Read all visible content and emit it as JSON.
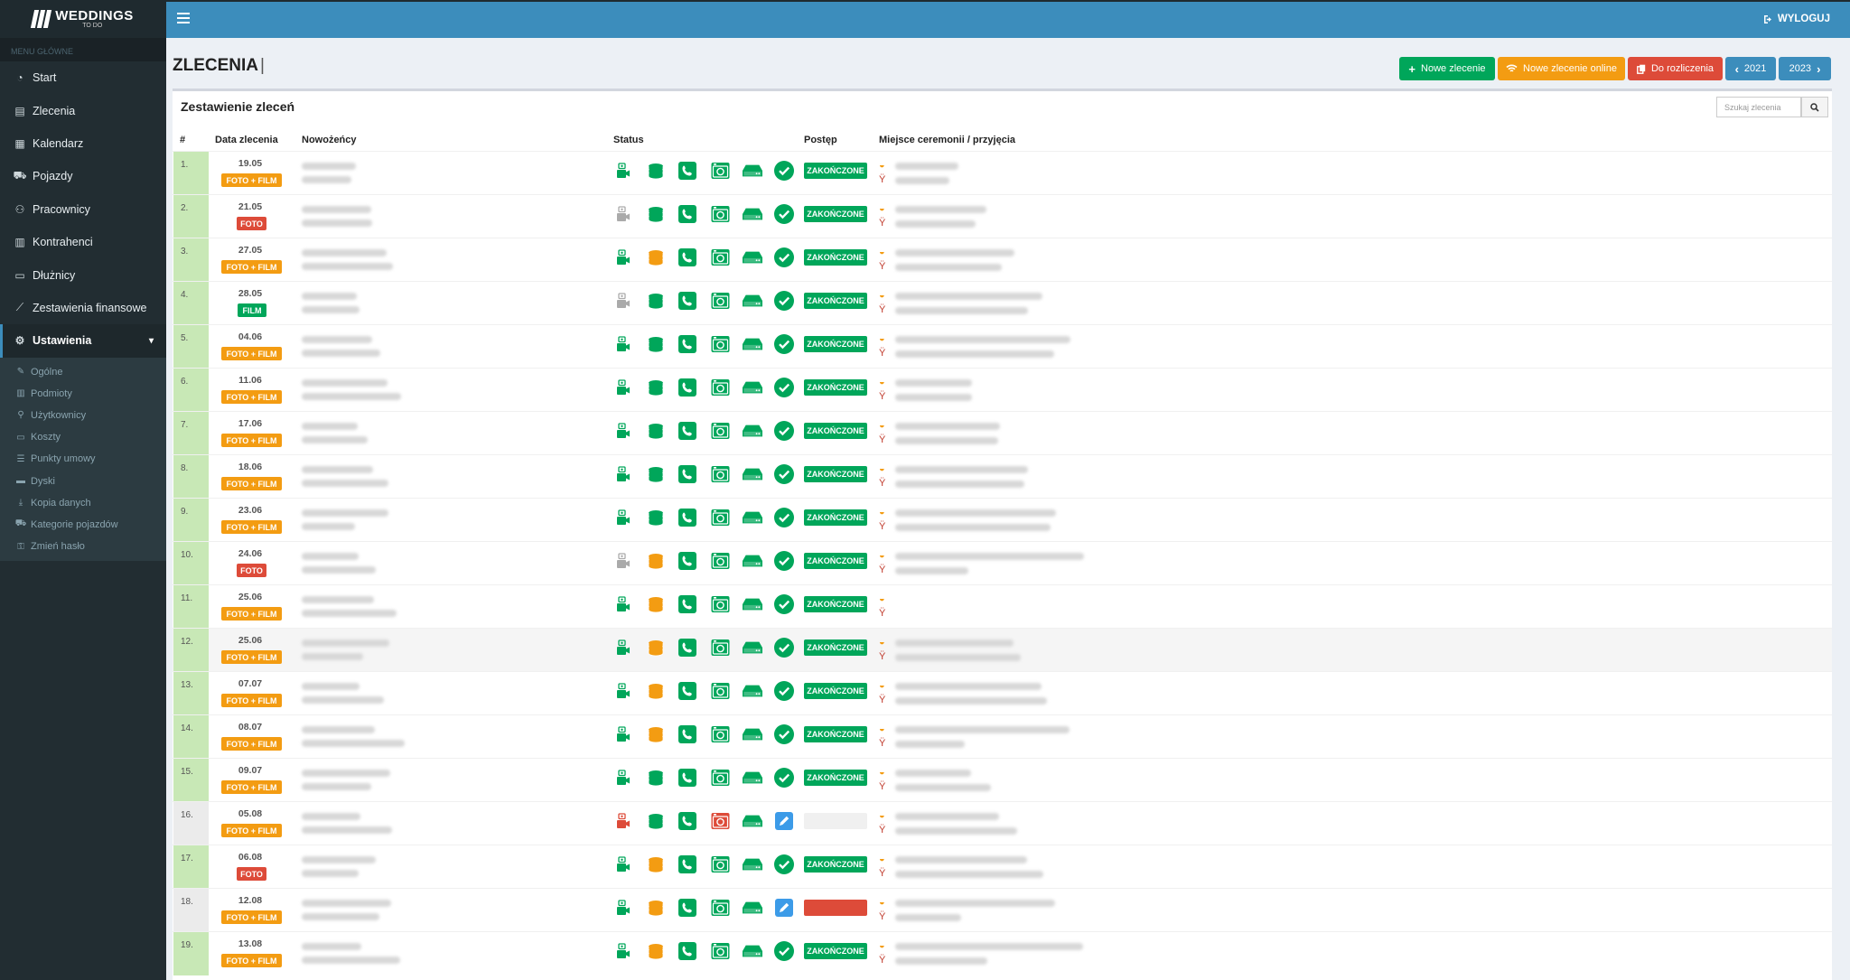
{
  "app": {
    "logo_text": "WEDDINGS",
    "logo_sub": "TO DO",
    "menu_header": "MENU GŁÓWNE",
    "logout": "WYLOGUJ"
  },
  "nav": [
    {
      "label": "Start",
      "icon": "tachometer-icon"
    },
    {
      "label": "Zlecenia",
      "icon": "file-icon"
    },
    {
      "label": "Kalendarz",
      "icon": "calendar-icon"
    },
    {
      "label": "Pojazdy",
      "icon": "car-icon"
    },
    {
      "label": "Pracownicy",
      "icon": "users-icon"
    },
    {
      "label": "Kontrahenci",
      "icon": "building-icon"
    },
    {
      "label": "Dłużnicy",
      "icon": "money-icon"
    },
    {
      "label": "Zestawienia finansowe",
      "icon": "line-chart-icon"
    },
    {
      "label": "Ustawienia",
      "icon": "gear-icon",
      "active": true
    }
  ],
  "subnav": [
    {
      "label": "Ogólne",
      "icon": "wrench-icon"
    },
    {
      "label": "Podmioty",
      "icon": "bank-icon"
    },
    {
      "label": "Użytkownicy",
      "icon": "user-plus-icon"
    },
    {
      "label": "Koszty",
      "icon": "money-icon"
    },
    {
      "label": "Punkty umowy",
      "icon": "list-icon"
    },
    {
      "label": "Dyski",
      "icon": "hdd-icon"
    },
    {
      "label": "Kopia danych",
      "icon": "download-icon"
    },
    {
      "label": "Kategorie pojazdów",
      "icon": "car-icon"
    },
    {
      "label": "Zmień hasło",
      "icon": "lock-icon"
    }
  ],
  "header": {
    "title": "ZLECENIA",
    "caret": "|"
  },
  "buttons": {
    "new_order": "Nowe zlecenie",
    "new_online": "Nowe zlecenie online",
    "to_settle": "Do rozliczenia",
    "prev_year": "2021",
    "next_year": "2023"
  },
  "box": {
    "title": "Zestawienie zleceń",
    "search_placeholder": "Szukaj zlecenia"
  },
  "columns": {
    "num": "#",
    "date": "Data zlecenia",
    "couple": "Nowożeńcy",
    "status": "Status",
    "progress": "Postęp",
    "place": "Miejsce ceremonii / przyjęcia"
  },
  "colors": {
    "green": "#00a65a",
    "orange": "#f39c12",
    "red": "#dd4b39",
    "blue": "#3c8dbc"
  },
  "rows": [
    {
      "num": "1.",
      "date": "19.05",
      "type": "FOTO + FILM",
      "progress": "ZAKOŃCZONE",
      "coin": "green"
    },
    {
      "num": "2.",
      "date": "21.05",
      "type": "FOTO",
      "progress": "ZAKOŃCZONE",
      "coin": "green",
      "cam": "grey"
    },
    {
      "num": "3.",
      "date": "27.05",
      "type": "FOTO + FILM",
      "progress": "ZAKOŃCZONE",
      "coin": "orange"
    },
    {
      "num": "4.",
      "date": "28.05",
      "type": "FILM",
      "progress": "ZAKOŃCZONE",
      "coin": "green",
      "cam": "grey"
    },
    {
      "num": "5.",
      "date": "04.06",
      "type": "FOTO + FILM",
      "progress": "ZAKOŃCZONE",
      "coin": "green"
    },
    {
      "num": "6.",
      "date": "11.06",
      "type": "FOTO + FILM",
      "progress": "ZAKOŃCZONE",
      "coin": "green"
    },
    {
      "num": "7.",
      "date": "17.06",
      "type": "FOTO + FILM",
      "progress": "ZAKOŃCZONE",
      "coin": "green"
    },
    {
      "num": "8.",
      "date": "18.06",
      "type": "FOTO + FILM",
      "progress": "ZAKOŃCZONE",
      "coin": "green"
    },
    {
      "num": "9.",
      "date": "23.06",
      "type": "FOTO + FILM",
      "progress": "ZAKOŃCZONE",
      "coin": "green"
    },
    {
      "num": "10.",
      "date": "24.06",
      "type": "FOTO",
      "progress": "ZAKOŃCZONE",
      "coin": "orange",
      "cam": "grey"
    },
    {
      "num": "11.",
      "date": "25.06",
      "type": "FOTO + FILM",
      "progress": "ZAKOŃCZONE",
      "coin": "orange",
      "noplace": true
    },
    {
      "num": "12.",
      "date": "25.06",
      "type": "FOTO + FILM",
      "progress": "ZAKOŃCZONE",
      "coin": "orange",
      "hl": true
    },
    {
      "num": "13.",
      "date": "07.07",
      "type": "FOTO + FILM",
      "progress": "ZAKOŃCZONE",
      "coin": "orange"
    },
    {
      "num": "14.",
      "date": "08.07",
      "type": "FOTO + FILM",
      "progress": "ZAKOŃCZONE",
      "coin": "orange"
    },
    {
      "num": "15.",
      "date": "09.07",
      "type": "FOTO + FILM",
      "progress": "ZAKOŃCZONE",
      "coin": "green"
    },
    {
      "num": "16.",
      "date": "05.08",
      "type": "FOTO + FILM",
      "progress": "",
      "coin": "green",
      "cam": "red",
      "edit": true,
      "pstate": "empty",
      "grey": true
    },
    {
      "num": "17.",
      "date": "06.08",
      "type": "FOTO",
      "progress": "ZAKOŃCZONE",
      "coin": "orange"
    },
    {
      "num": "18.",
      "date": "12.08",
      "type": "FOTO + FILM",
      "progress": "",
      "coin": "orange",
      "edit": true,
      "pstate": "red",
      "grey": true
    },
    {
      "num": "19.",
      "date": "13.08",
      "type": "FOTO + FILM",
      "progress": "ZAKOŃCZONE",
      "coin": "orange"
    }
  ]
}
